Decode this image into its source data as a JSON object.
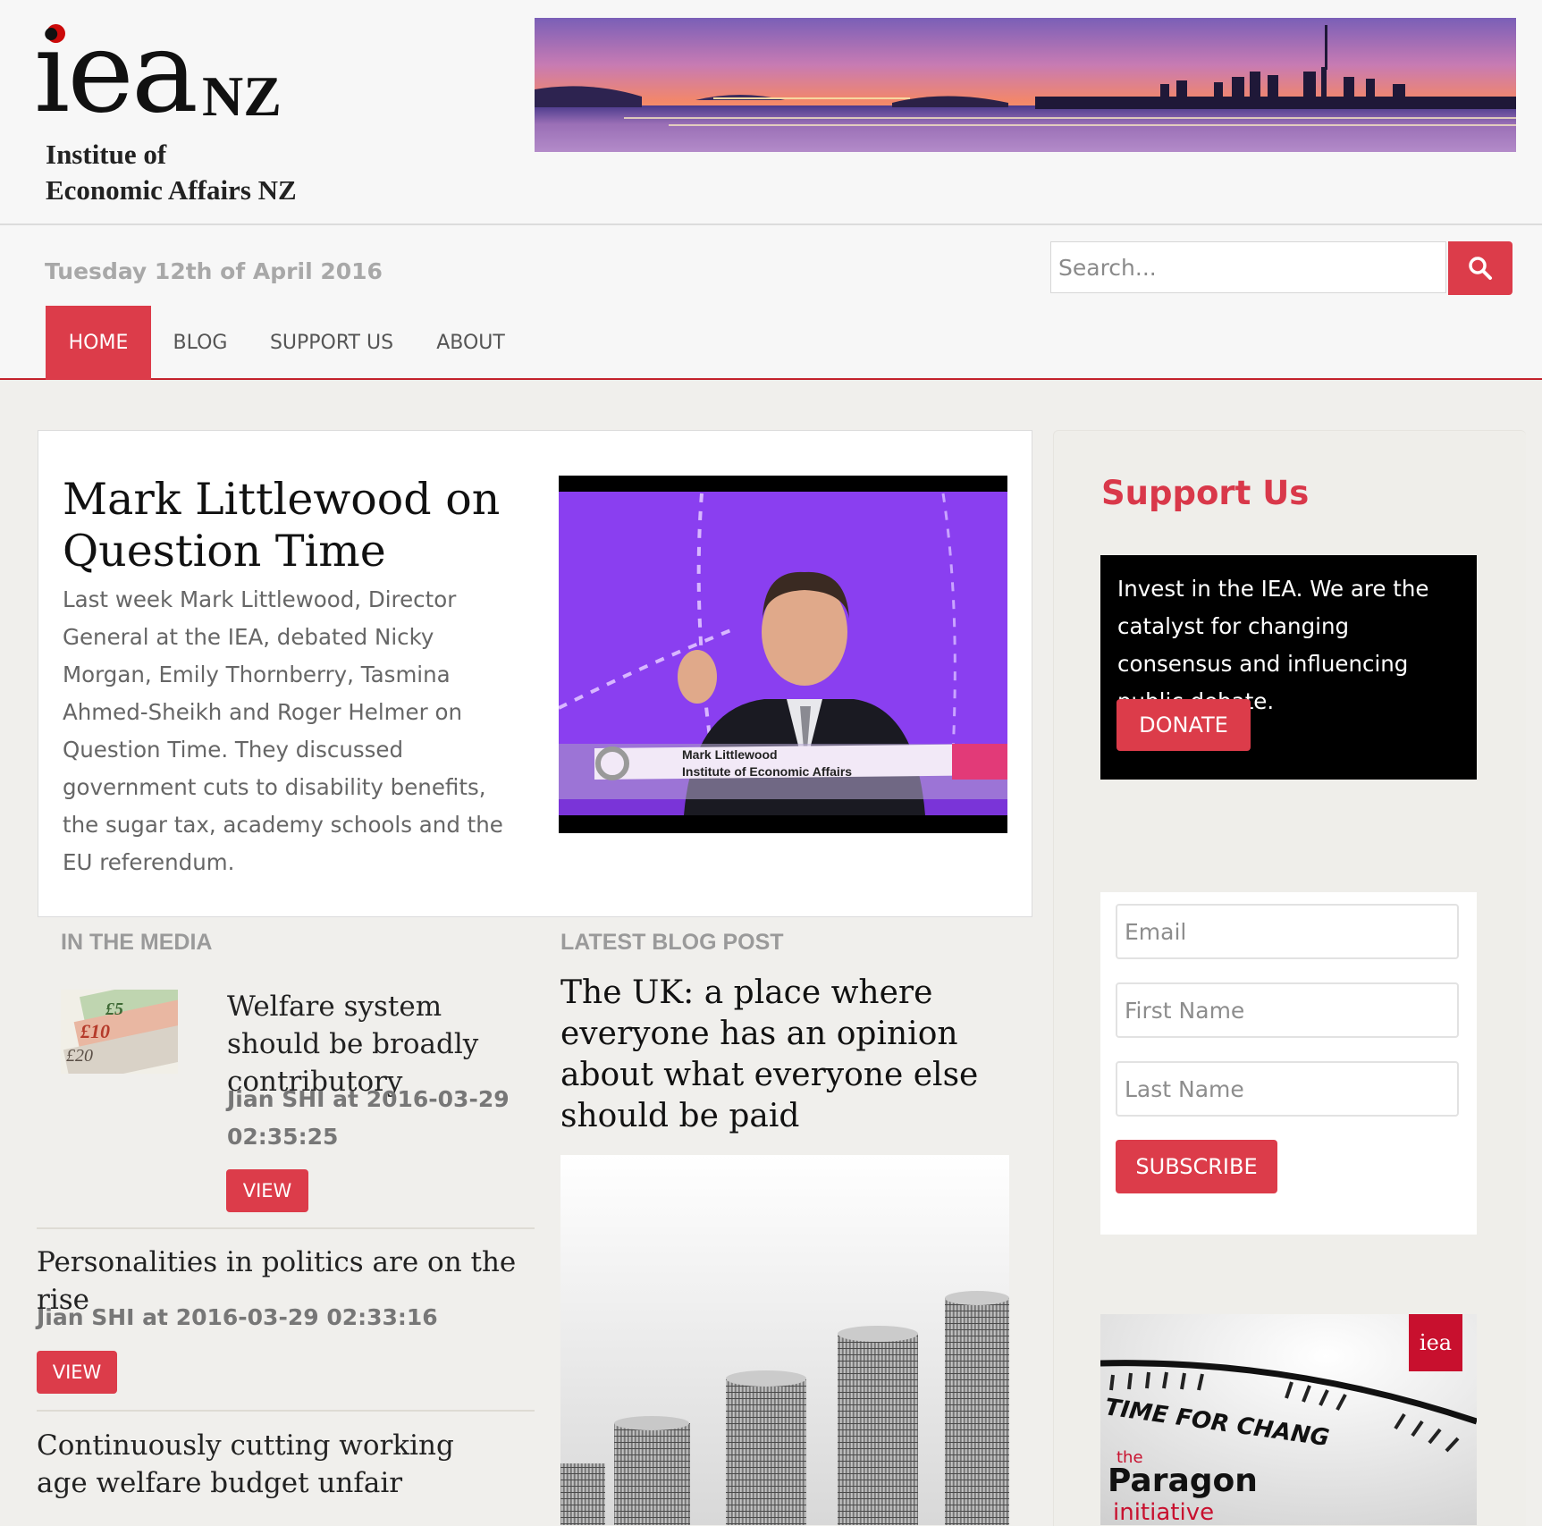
{
  "header": {
    "logo": {
      "mark": "iea",
      "suffix": "NZ",
      "line1": "Institue of",
      "line2": "Economic Affairs NZ"
    },
    "banner_alt": "city-skyline-banner"
  },
  "date_text": "Tuesday 12th of April 2016",
  "search": {
    "placeholder": "Search...",
    "button_icon": "search-icon"
  },
  "nav": {
    "home": "HOME",
    "blog": "BLOG",
    "support": "SUPPORT US",
    "about": "ABOUT"
  },
  "featured": {
    "title": "Mark Littlewood on Question Time",
    "body": "Last week Mark Littlewood, Director General at the IEA, debated Nicky Morgan, Emily Thornberry, Tasmina Ahmed-Sheikh and Roger Helmer on Question Time. They discussed government cuts to disability benefits, the sugar tax, academy schools and the EU referendum.",
    "caption_name": "Mark Littlewood",
    "caption_org": "Institute of Economic Affairs"
  },
  "media": {
    "heading": "IN THE MEDIA",
    "items": [
      {
        "title": "Welfare system should be broadly contributory",
        "meta": "Jian SHI at 2016-03-29 02:35:25",
        "button": "VIEW",
        "thumb_labels": [
          "£5",
          "£10",
          "£20"
        ]
      },
      {
        "title": "Personalities in politics are on the rise",
        "meta": "Jian SHI at 2016-03-29 02:33:16",
        "button": "VIEW"
      },
      {
        "title": "Continuously cutting working age welfare budget unfair"
      }
    ]
  },
  "blog": {
    "heading": "LATEST BLOG POST",
    "title": "The UK: a place where everyone has an opinion about what everyone else should be paid"
  },
  "sidebar": {
    "support_heading": "Support Us",
    "support_text": "Invest in the IEA. We are the catalyst for changing consensus and influencing public debate.",
    "donate_label": "DONATE",
    "email_placeholder": "Email",
    "first_name_placeholder": "First Name",
    "last_name_placeholder": "Last Name",
    "subscribe_label": "SUBSCRIBE",
    "promo": {
      "badge": "iea",
      "headline": "TIME FOR CHANG",
      "brand_prefix": "the",
      "brand": "Paragon",
      "brand_sub": "initiative"
    }
  },
  "colors": {
    "accent": "#dc3c4a",
    "background": "#f0efec",
    "header": "#f7f7f7"
  }
}
